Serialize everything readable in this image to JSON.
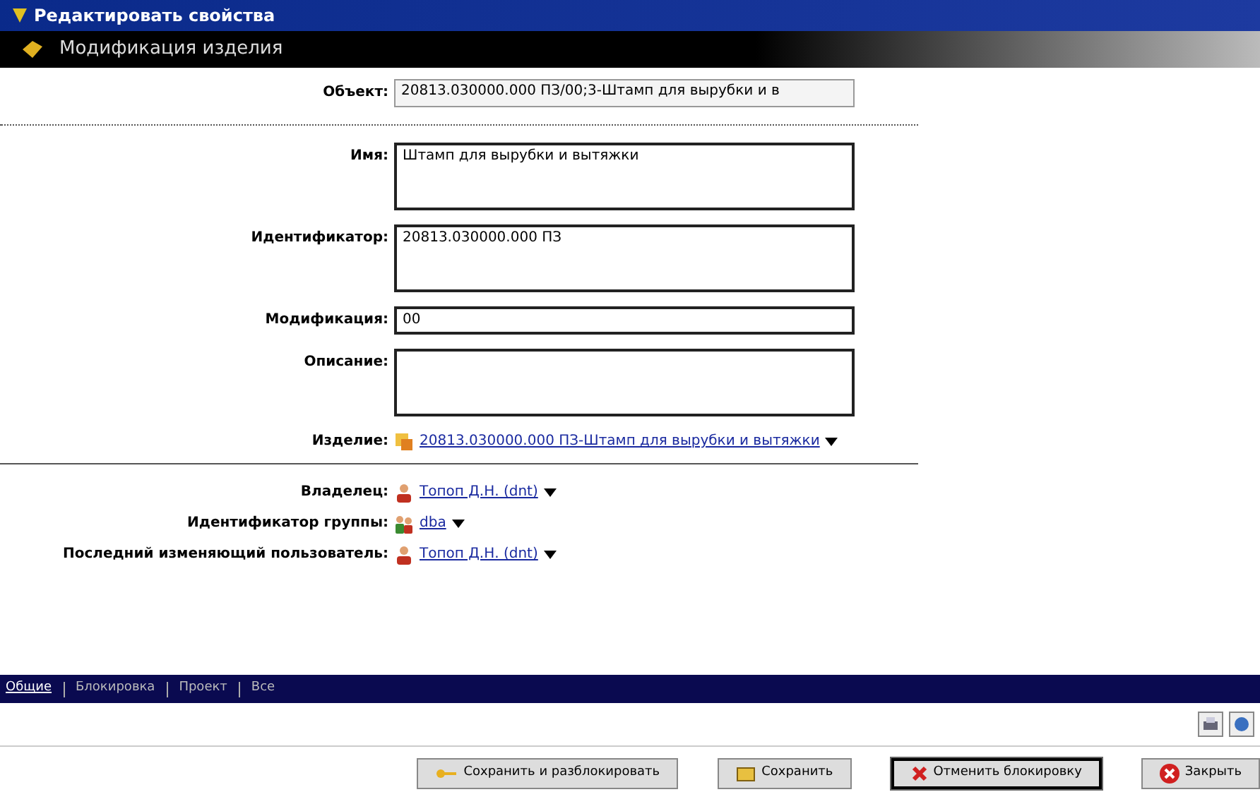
{
  "window": {
    "title": "Редактировать свойства"
  },
  "header": {
    "title": "Модификация изделия"
  },
  "fields": [
    {
      "label": "Объект:",
      "value": "20813.030000.000 ПЗ/00;3-Штамп для вырубки и в",
      "kind": "readonly"
    },
    {
      "label": "Имя:",
      "value": "Штамп для вырубки и вытяжки",
      "kind": "multiline"
    },
    {
      "label": "Идентификатор:",
      "value": "20813.030000.000 ПЗ",
      "kind": "multiline"
    },
    {
      "label": "Модификация:",
      "value": "00",
      "kind": "single"
    },
    {
      "label": "Описание:",
      "kind": "multiline"
    }
  ],
  "product": {
    "label": "Изделие:",
    "link": "20813.030000.000 ПЗ-Штамп для вырубки и вытяжки"
  },
  "people": [
    {
      "label": "Владелец:",
      "link": "Топоп Д.Н. (dnt)",
      "kind": "user"
    },
    {
      "label": "Идентификатор группы:",
      "link": "dba",
      "kind": "group"
    },
    {
      "label": "Последний изменяющий пользователь:",
      "link": "Топоп Д.Н. (dnt)",
      "kind": "user"
    }
  ],
  "tabs": [
    {
      "label": "Общие",
      "selected": true
    },
    {
      "label": "Блокировка",
      "selected": false
    },
    {
      "label": "Проект",
      "selected": false
    },
    {
      "label": "Все",
      "selected": false
    }
  ],
  "buttons": [
    {
      "label": "Сохранить и разблокировать",
      "kind": "save-unlock",
      "default": false
    },
    {
      "label": "Сохранить",
      "kind": "save",
      "default": false
    },
    {
      "label": "Отменить блокировку",
      "kind": "cancel-lock",
      "default": true
    },
    {
      "label": "Закрыть",
      "kind": "close",
      "default": false
    }
  ]
}
